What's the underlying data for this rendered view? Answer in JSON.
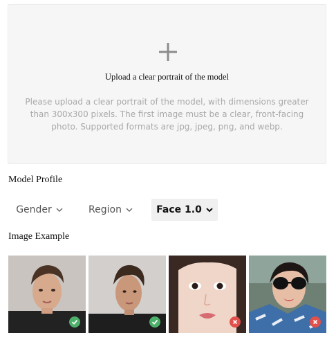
{
  "upload": {
    "icon": "plus-icon",
    "title": "Upload a clear portrait of the model",
    "description": "Please upload a clear portrait of the model, with dimensions greater than 300x300 pixels. The first image must be a clear, front-facing photo. Supported formats are jpg, jpeg, png, and webp."
  },
  "profile": {
    "title": "Model Profile",
    "filters": {
      "gender": "Gender",
      "region": "Region",
      "face": "Face 1.0"
    }
  },
  "examples": {
    "title": "Image Example",
    "items": [
      {
        "status": "valid",
        "icon": "check-icon",
        "color": "#4caf6a"
      },
      {
        "status": "valid",
        "icon": "check-icon",
        "color": "#4caf6a"
      },
      {
        "status": "invalid",
        "icon": "close-icon",
        "color": "#e2504c"
      },
      {
        "status": "invalid",
        "icon": "close-icon",
        "color": "#e2504c"
      }
    ]
  }
}
